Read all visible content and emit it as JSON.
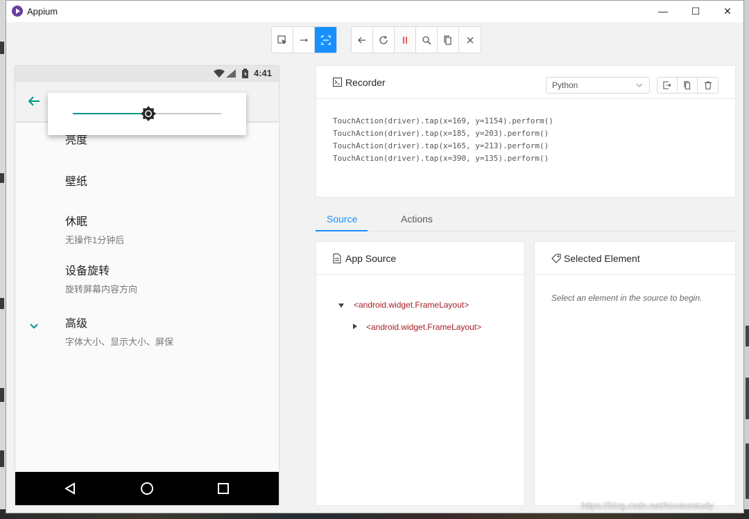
{
  "window": {
    "title": "Appium",
    "controls": {
      "minimize": "—",
      "maximize": "☐",
      "close": "✕"
    }
  },
  "toolbar": {
    "group1": [
      {
        "icon": "select-element-icon",
        "active": false
      },
      {
        "icon": "swipe-by-coordinates-icon",
        "active": false
      },
      {
        "icon": "tap-by-coordinates-icon",
        "active": true
      }
    ],
    "group2": [
      {
        "icon": "back-icon"
      },
      {
        "icon": "refresh-icon"
      },
      {
        "icon": "pause-recording-icon",
        "color": "#f5222d"
      },
      {
        "icon": "search-icon"
      },
      {
        "icon": "copy-xml-icon"
      },
      {
        "icon": "quit-session-icon"
      }
    ]
  },
  "phone": {
    "status_time": "4:41",
    "settings": [
      {
        "title": "亮度",
        "subtitle": ""
      },
      {
        "title": "壁纸",
        "subtitle": ""
      },
      {
        "title": "休眠",
        "subtitle": "无操作1分钟后"
      },
      {
        "title": "设备旋转",
        "subtitle": "旋转屏幕内容方向"
      },
      {
        "title": "高级",
        "subtitle": "字体大小、显示大小、屏保"
      }
    ],
    "brightness_level": 0.51,
    "accent_color": "#009688"
  },
  "recorder": {
    "title": "Recorder",
    "language": "Python",
    "code_lines": [
      "TouchAction(driver).tap(x=169, y=1154).perform()",
      "TouchAction(driver).tap(x=185, y=203).perform()",
      "TouchAction(driver).tap(x=165, y=213).perform()",
      "TouchAction(driver).tap(x=390, y=135).perform()"
    ]
  },
  "tabs": [
    {
      "label": "Source",
      "active": true
    },
    {
      "label": "Actions",
      "active": false
    }
  ],
  "app_source": {
    "title": "App Source",
    "nodes": [
      {
        "label": "<android.widget.FrameLayout>",
        "expanded": true
      },
      {
        "label": "<android.widget.FrameLayout>",
        "expanded": false
      }
    ]
  },
  "selected_element": {
    "title": "Selected Element",
    "hint": "Select an element in the source to begin."
  },
  "watermark": "https://blog.csdn.net/Novicestudy"
}
